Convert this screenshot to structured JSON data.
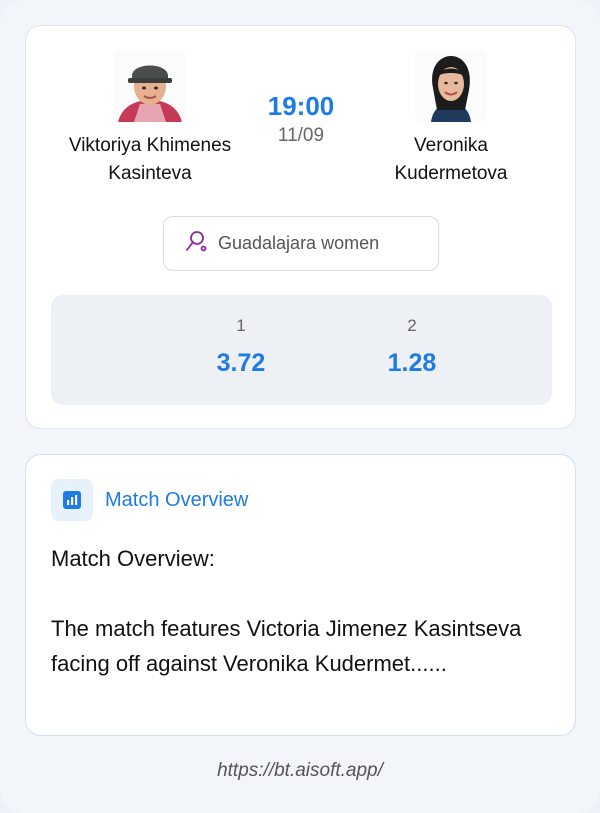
{
  "match": {
    "home_player": {
      "name": "Viktoriya Khimenes Kasinteva"
    },
    "away_player": {
      "name": "Veronika Kudermetova"
    },
    "time": "19:00",
    "date": "11/09",
    "tournament": {
      "label": "Guadalajara women",
      "icon": "tennis-racket-icon"
    }
  },
  "odds": [
    {
      "label": "1",
      "value": "3.72"
    },
    {
      "label": "2",
      "value": "1.28"
    }
  ],
  "overview": {
    "title": "Match Overview",
    "icon": "bar-chart-icon",
    "heading": "Match Overview:",
    "text": "The match features Victoria Jimenez Kasintseva facing off against Veronika Kudermet......"
  },
  "footer": {
    "url": "https://bt.aisoft.app/"
  },
  "colors": {
    "accent": "#1d7be3",
    "background": "#eef2f8",
    "card": "#ffffff",
    "odds_bg": "#edf0f5",
    "tournament_icon": "#8a2a9e"
  }
}
